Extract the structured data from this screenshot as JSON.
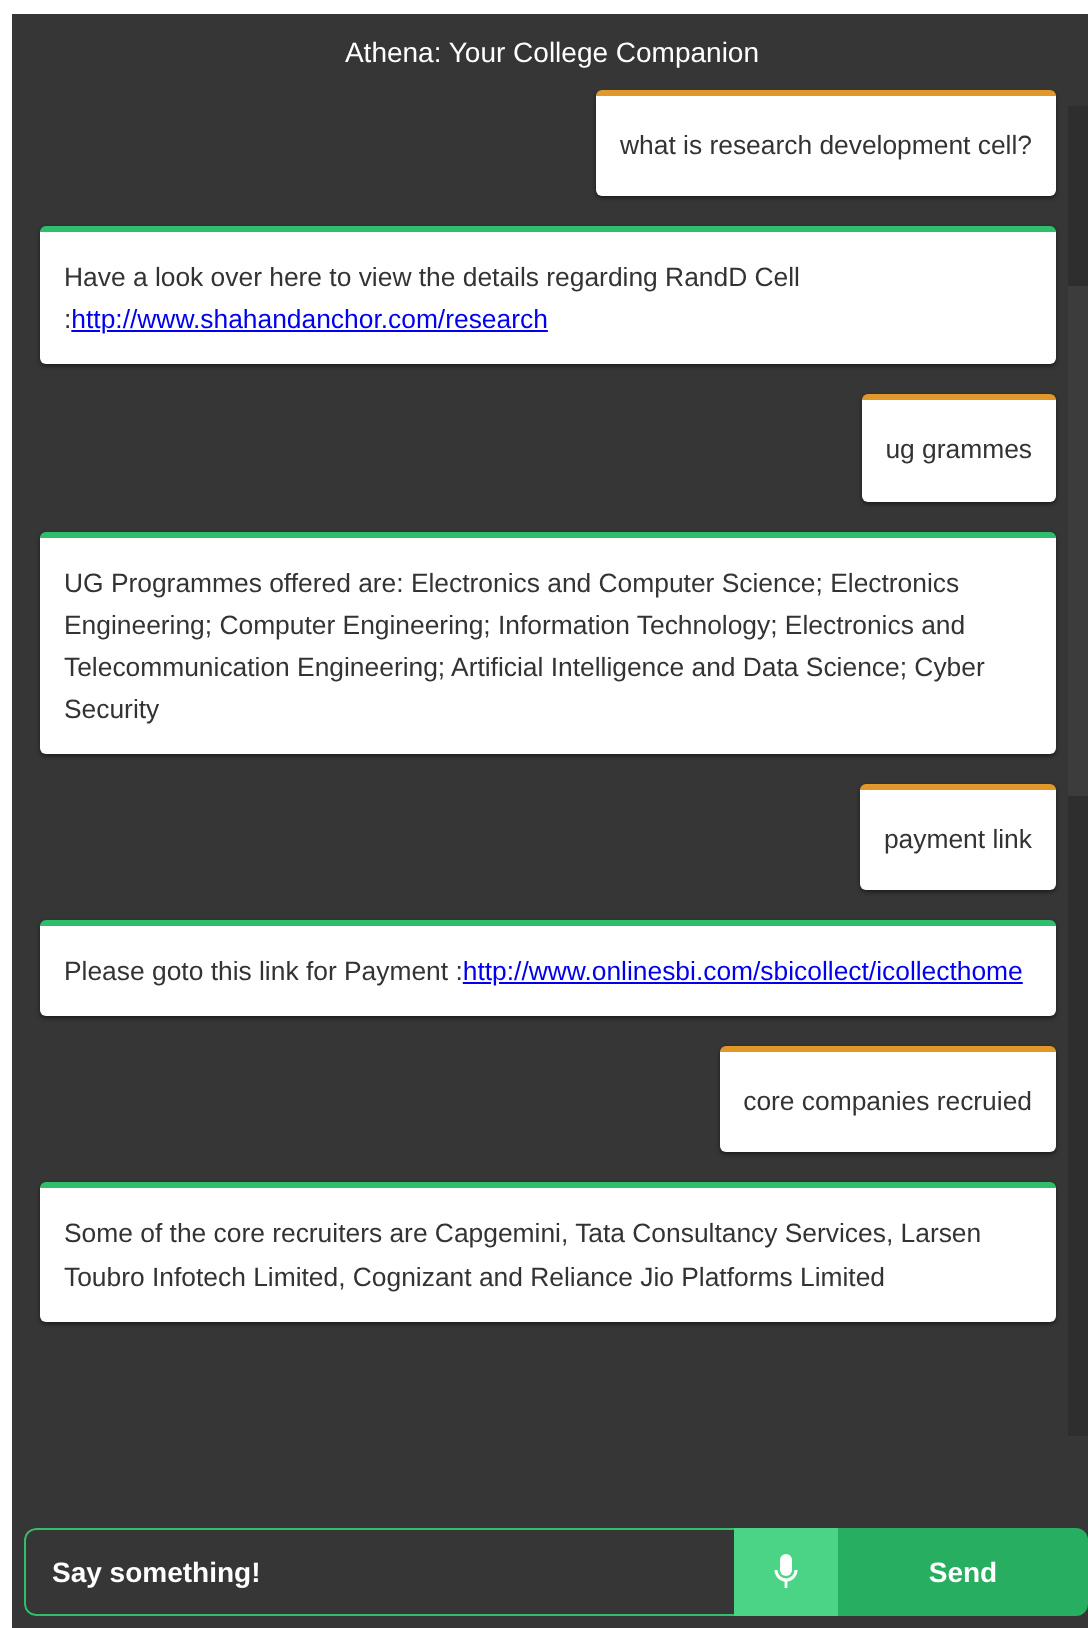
{
  "window": {
    "title": "Athena: Your College Companion"
  },
  "messages": [
    {
      "kind": "user",
      "text": "what is research development cell?"
    },
    {
      "kind": "bot",
      "text": "Have a look over here to view the details regarding RandD Cell",
      "link_lead": ":",
      "link": "http://www.shahandanchor.com/research"
    },
    {
      "kind": "user",
      "text": "ug grammes"
    },
    {
      "kind": "bot",
      "text": "UG Programmes offered are: Electronics and Computer Science; Electronics Engineering; Computer Engineering; Information Technology; Electronics and Telecommunication Engineering; Artificial Intelligence and Data Science; Cyber Security"
    },
    {
      "kind": "user",
      "text": "payment link"
    },
    {
      "kind": "bot",
      "text": "Please goto this link for Payment",
      "link_lead": ":",
      "link": "http://www.onlinesbi.com/sbicollect/icollecthome"
    },
    {
      "kind": "user",
      "text": "core companies recruied"
    },
    {
      "kind": "bot",
      "text": "Some of the core recruiters are Capgemini, Tata Consultancy Services, Larsen Toubro Infotech Limited, Cognizant and Reliance Jio Platforms Limited"
    }
  ],
  "input": {
    "placeholder": "Say something!"
  },
  "send_button": "Send"
}
